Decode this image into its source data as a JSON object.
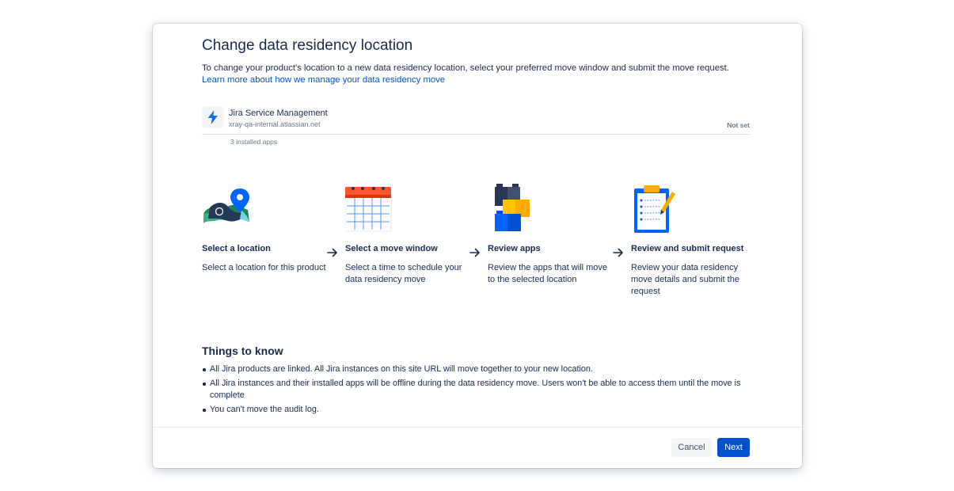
{
  "modal": {
    "title": "Change data residency location",
    "intro_text": "To change your product's location to a new data residency location, select your preferred move window and submit the move request. ",
    "intro_link": "Learn more about how we manage your data residency move"
  },
  "product": {
    "icon": "jira-service-management-lightning-icon",
    "name": "Jira Service Management",
    "url": "xray-qa-internal.atlassian.net",
    "status": "Not set",
    "installed_apps": "3 installed apps"
  },
  "steps": [
    {
      "illustration": "map-location-pin-icon",
      "title": "Select a location",
      "description": "Select a location for this product"
    },
    {
      "illustration": "calendar-icon",
      "title": "Select a move window",
      "description": "Select a time to schedule your data residency move"
    },
    {
      "illustration": "stacked-blocks-icon",
      "title": "Review apps",
      "description": "Review the apps that will move to the selected location"
    },
    {
      "illustration": "clipboard-checklist-icon",
      "title": "Review and submit request",
      "description": "Review your data residency move details and submit the request"
    }
  ],
  "things_to_know": {
    "title": "Things to know",
    "items": [
      "All Jira products are linked. All Jira instances on this site URL will move together to your new location.",
      "All Jira instances and their installed apps will be offline during the data residency move. Users won't be able to access them until the move is complete",
      "You can't move the audit log."
    ]
  },
  "footer": {
    "cancel_label": "Cancel",
    "next_label": "Next"
  },
  "colors": {
    "primary": "#0052cc",
    "text": "#172b4d",
    "subtle_text": "#6b778c",
    "divider": "#dfe1e6"
  }
}
